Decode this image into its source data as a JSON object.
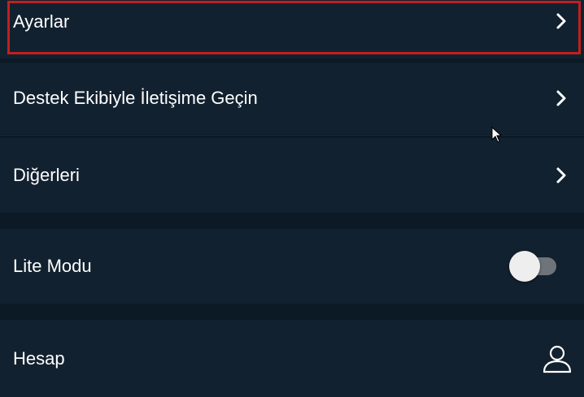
{
  "menu": {
    "items": [
      {
        "label": "Ayarlar",
        "trailing": "chevron-right-icon"
      },
      {
        "label": "Destek Ekibiyle İletişime Geçin",
        "trailing": "chevron-right-icon"
      },
      {
        "label": "Diğerleri",
        "trailing": "chevron-right-icon"
      },
      {
        "label": "Lite Modu",
        "trailing": "toggle",
        "toggle_on": false
      },
      {
        "label": "Hesap",
        "trailing": "user-icon"
      }
    ]
  },
  "colors": {
    "background": "#0c1a26",
    "row_background": "#12212f",
    "text": "#ffffff",
    "highlight_border": "#c0201f",
    "toggle_track": "#6e747a",
    "toggle_knob": "#eeeeee"
  }
}
